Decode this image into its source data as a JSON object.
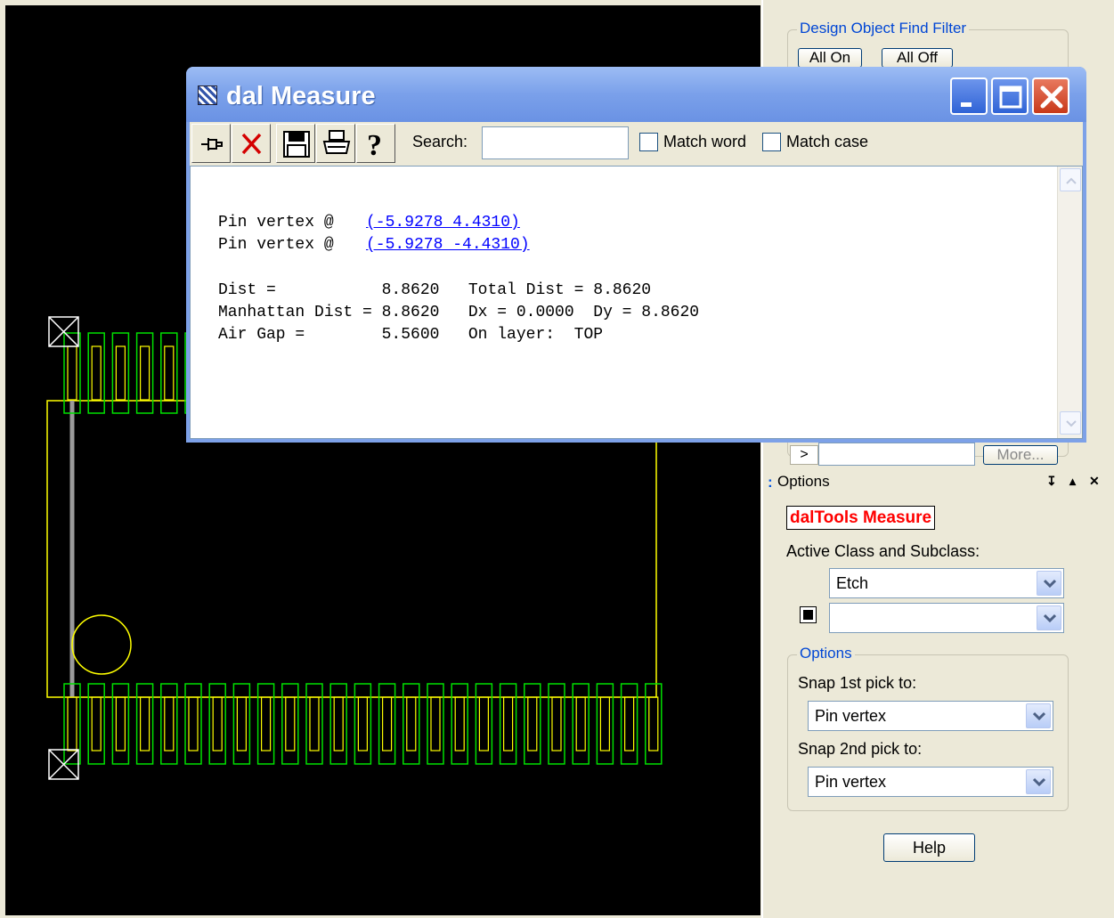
{
  "find_filter": {
    "legend": "Design Object Find Filter",
    "all_on": "All On",
    "all_off": "All Off",
    "nav_button": ">",
    "more_button": "More..."
  },
  "options_panel": {
    "header": "Options",
    "pin_icon": "pushpin-icon",
    "collapse_icon": "triangle-up-icon",
    "close_icon": "close-icon",
    "tool_title": "dalTools Measure",
    "active_class_label": "Active Class and Subclass:",
    "class_value": "Etch",
    "subclass_value": "",
    "options_legend": "Options",
    "snap1_label": "Snap 1st pick to:",
    "snap1_value": "Pin vertex",
    "snap2_label": "Snap 2nd pick to:",
    "snap2_value": "Pin vertex",
    "help_button": "Help"
  },
  "dialog": {
    "title": "dal Measure",
    "toolbar": {
      "icons": [
        "pushpin-icon",
        "delete-x-icon",
        "save-icon",
        "print-icon",
        "help-icon"
      ],
      "search_label": "Search:",
      "search_value": "",
      "match_word": "Match word",
      "match_case": "Match case"
    },
    "lines": {
      "pin1_prefix": "Pin vertex @",
      "pin1_link": "(-5.9278 4.4310)",
      "pin2_prefix": "Pin vertex @",
      "pin2_link": "(-5.9278 -4.4310)",
      "dist": "Dist =           8.8620   Total Dist = 8.8620",
      "manhattan": "Manhattan Dist = 8.8620   Dx = 0.0000  Dy = 8.8620",
      "airgap": "Air Gap =        5.5600   On layer:  TOP"
    }
  },
  "colors": {
    "pad_outline": "#00e000",
    "body_outline": "#ffff00",
    "accent_blue": "#0046d5",
    "tool_title_red": "#ff0000"
  }
}
